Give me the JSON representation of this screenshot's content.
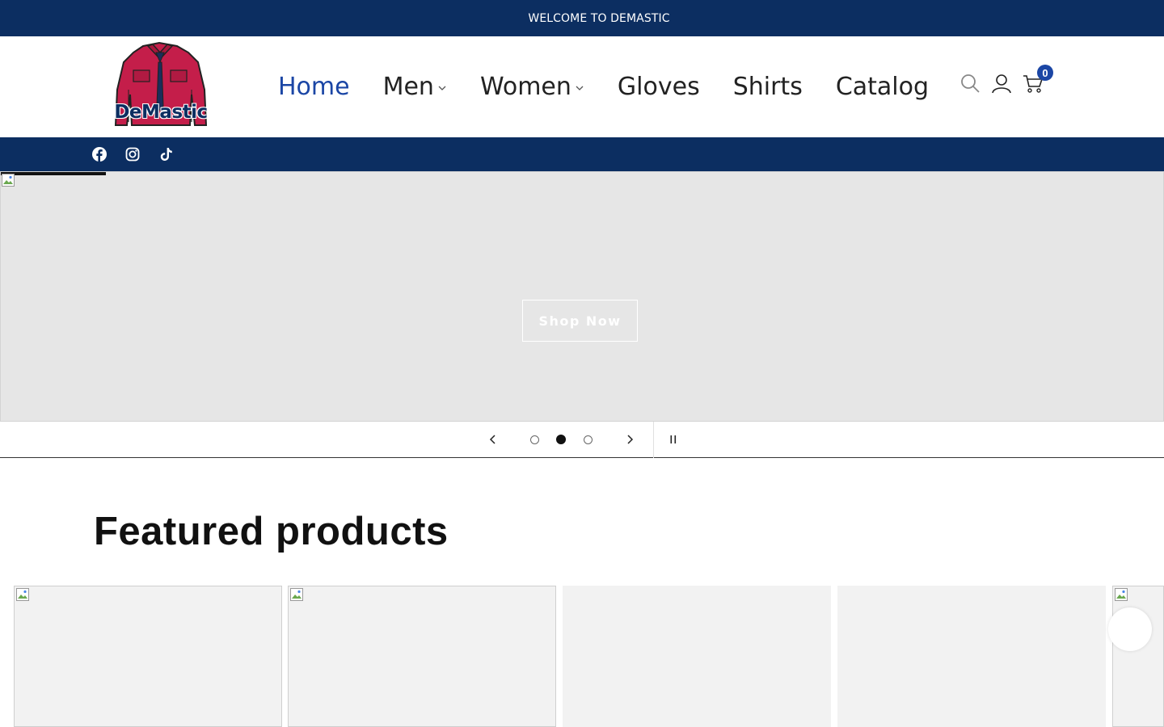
{
  "announcement": {
    "text": "WELCOME TO DEMASTIC"
  },
  "brand": {
    "logo_text": "DeMastic",
    "primary_color": "#0c2e61",
    "accent_color": "#1b46a5",
    "jacket_color": "#c41e4a"
  },
  "nav": {
    "items": [
      {
        "label": "Home",
        "active": true,
        "has_dropdown": false
      },
      {
        "label": "Men",
        "active": false,
        "has_dropdown": true
      },
      {
        "label": "Women",
        "active": false,
        "has_dropdown": true
      },
      {
        "label": "Gloves",
        "active": false,
        "has_dropdown": false
      },
      {
        "label": "Shirts",
        "active": false,
        "has_dropdown": false
      },
      {
        "label": "Catalog",
        "active": false,
        "has_dropdown": false
      }
    ]
  },
  "header_icons": {
    "search": "search-icon",
    "account": "account-icon",
    "cart": "cart-icon",
    "cart_count": "0"
  },
  "social": [
    "facebook-icon",
    "instagram-icon",
    "tiktok-icon"
  ],
  "slideshow": {
    "button_label": "Shop Now",
    "total_slides": 3,
    "current_slide": 2,
    "progress": 0.09
  },
  "featured": {
    "title": "Featured products"
  }
}
